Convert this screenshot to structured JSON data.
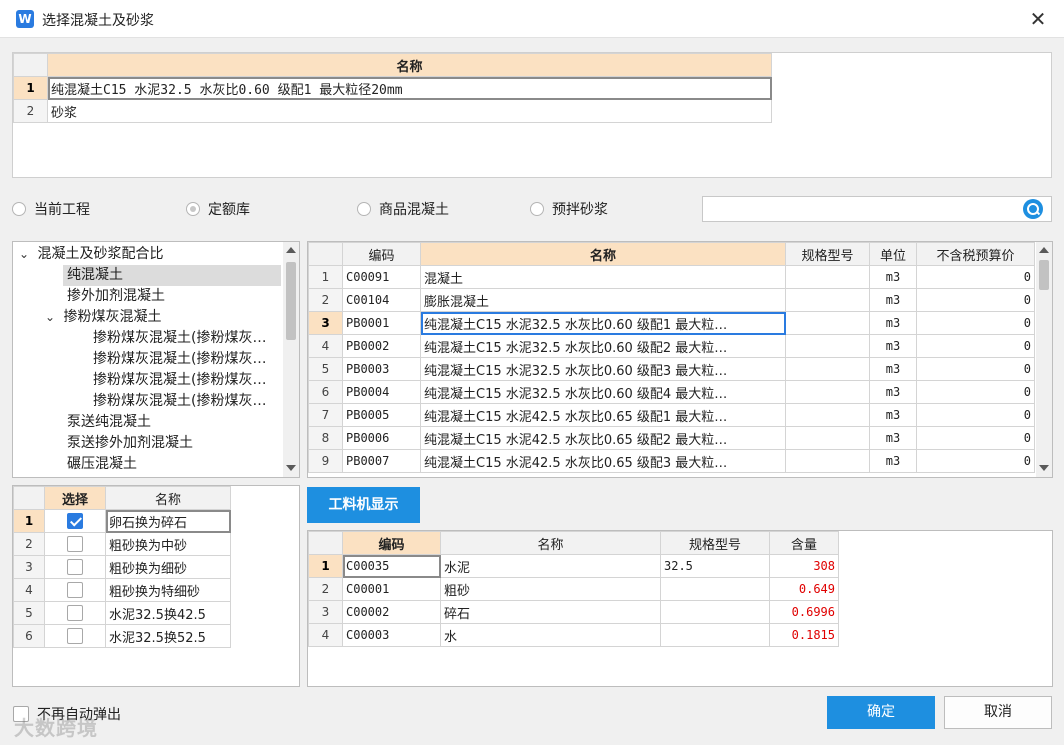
{
  "window": {
    "title": "选择混凝土及砂浆",
    "icon_letter": "W",
    "close_glyph": "✕"
  },
  "top_table": {
    "header": "名称",
    "rows": [
      {
        "num": "1",
        "name": "纯混凝土C15 水泥32.5 水灰比0.60 级配1 最大粒径20mm"
      },
      {
        "num": "2",
        "name": "砂浆"
      }
    ]
  },
  "filters": {
    "options": [
      "当前工程",
      "定额库",
      "商品混凝土",
      "预拌砂浆"
    ],
    "selected": "定额库",
    "search_placeholder": ""
  },
  "tree": {
    "items": [
      {
        "label": "混凝土及砂浆配合比",
        "expanded": true
      },
      {
        "label": "纯混凝土",
        "selected": true
      },
      {
        "label": "掺外加剂混凝土"
      },
      {
        "label": "掺粉煤灰混凝土",
        "expanded": true
      },
      {
        "label": "掺粉煤灰混凝土(掺粉煤灰…"
      },
      {
        "label": "掺粉煤灰混凝土(掺粉煤灰…"
      },
      {
        "label": "掺粉煤灰混凝土(掺粉煤灰…"
      },
      {
        "label": "掺粉煤灰混凝土(掺粉煤灰…"
      },
      {
        "label": "泵送纯混凝土"
      },
      {
        "label": "泵送掺外加剂混凝土"
      },
      {
        "label": "碾压混凝土"
      }
    ]
  },
  "options_table": {
    "headers": [
      "选择",
      "名称"
    ],
    "rows": [
      {
        "num": "1",
        "checked": true,
        "name": "卵石换为碎石"
      },
      {
        "num": "2",
        "checked": false,
        "name": "粗砂换为中砂"
      },
      {
        "num": "3",
        "checked": false,
        "name": "粗砂换为细砂"
      },
      {
        "num": "4",
        "checked": false,
        "name": "粗砂换为特细砂"
      },
      {
        "num": "5",
        "checked": false,
        "name": "水泥32.5换42.5"
      },
      {
        "num": "6",
        "checked": false,
        "name": "水泥32.5换52.5"
      }
    ]
  },
  "main_table": {
    "headers": [
      "编码",
      "名称",
      "规格型号",
      "单位",
      "不含税预算价"
    ],
    "rows": [
      {
        "num": "1",
        "code": "C00091",
        "name": "混凝土",
        "spec": "",
        "unit": "m3",
        "price": "0"
      },
      {
        "num": "2",
        "code": "C00104",
        "name": "膨胀混凝土",
        "spec": "",
        "unit": "m3",
        "price": "0"
      },
      {
        "num": "3",
        "code": "PB0001",
        "name": "纯混凝土C15 水泥32.5 水灰比0.60 级配1 最大粒…",
        "spec": "",
        "unit": "m3",
        "price": "0"
      },
      {
        "num": "4",
        "code": "PB0002",
        "name": "纯混凝土C15 水泥32.5 水灰比0.60 级配2 最大粒…",
        "spec": "",
        "unit": "m3",
        "price": "0"
      },
      {
        "num": "5",
        "code": "PB0003",
        "name": "纯混凝土C15 水泥32.5 水灰比0.60 级配3 最大粒…",
        "spec": "",
        "unit": "m3",
        "price": "0"
      },
      {
        "num": "6",
        "code": "PB0004",
        "name": "纯混凝土C15 水泥32.5 水灰比0.60 级配4 最大粒…",
        "spec": "",
        "unit": "m3",
        "price": "0"
      },
      {
        "num": "7",
        "code": "PB0005",
        "name": "纯混凝土C15 水泥42.5 水灰比0.65 级配1 最大粒…",
        "spec": "",
        "unit": "m3",
        "price": "0"
      },
      {
        "num": "8",
        "code": "PB0006",
        "name": "纯混凝土C15 水泥42.5 水灰比0.65 级配2 最大粒…",
        "spec": "",
        "unit": "m3",
        "price": "0"
      },
      {
        "num": "9",
        "code": "PB0007",
        "name": "纯混凝土C15 水泥42.5 水灰比0.65 级配3 最大粒…",
        "spec": "",
        "unit": "m3",
        "price": "0"
      }
    ]
  },
  "toggle_button": "工料机显示",
  "sub_table": {
    "headers": [
      "编码",
      "名称",
      "规格型号",
      "含量"
    ],
    "rows": [
      {
        "num": "1",
        "code": "C00035",
        "name": "水泥",
        "spec": "32.5",
        "qty": "308"
      },
      {
        "num": "2",
        "code": "C00001",
        "name": "粗砂",
        "spec": "",
        "qty": "0.649"
      },
      {
        "num": "3",
        "code": "C00002",
        "name": "碎石",
        "spec": "",
        "qty": "0.6996"
      },
      {
        "num": "4",
        "code": "C00003",
        "name": "水",
        "spec": "",
        "qty": "0.1815"
      }
    ]
  },
  "footer": {
    "no_popup_label": "不再自动弹出",
    "watermark": "大数跨境",
    "ok": "确定",
    "cancel": "取消"
  },
  "colors": {
    "accent": "#1e8fe0",
    "header_highlight": "#fbe1c2",
    "qty_red": "#e00000"
  }
}
